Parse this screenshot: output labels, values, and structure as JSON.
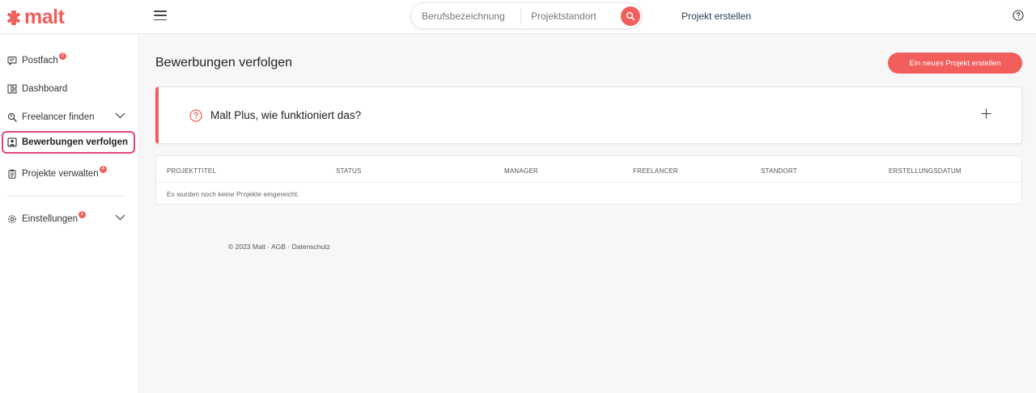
{
  "brand": {
    "name": "malt",
    "color": "#f15e5b"
  },
  "header": {
    "search": {
      "job_placeholder": "Berufsbezeichnung",
      "location_placeholder": "Projektstandort"
    },
    "create_project_link": "Projekt erstellen"
  },
  "sidebar": {
    "items": [
      {
        "label": "Postfach",
        "icon": "inbox-icon",
        "badge": "2"
      },
      {
        "label": "Dashboard",
        "icon": "dashboard-icon"
      },
      {
        "label": "Freelancer finden",
        "icon": "search-person-icon",
        "expandable": true
      },
      {
        "label": "Bewerbungen verfolgen",
        "icon": "applications-icon",
        "active": true
      },
      {
        "label": "Projekte verwalten",
        "icon": "clipboard-icon",
        "badge": "4"
      },
      {
        "label": "Einstellungen",
        "icon": "gear-icon",
        "badge": "1",
        "expandable": true
      }
    ]
  },
  "main": {
    "title": "Bewerbungen verfolgen",
    "cta_label": "Ein neues Projekt erstellen",
    "info_card": {
      "question": "Malt Plus, wie funktioniert das?"
    },
    "table": {
      "columns": [
        "PROJEKTTITEL",
        "STATUS",
        "MANAGER",
        "FREELANCER",
        "STANDORT",
        "ERSTELLUNGSDATUM"
      ],
      "empty_message": "Es wurden noch keine Projekte eingereicht."
    }
  },
  "footer": {
    "copyright": "© 2023 Malt",
    "sep1": "·",
    "agb": "AGB",
    "sep2": "·",
    "privacy": "Datenschutz"
  }
}
